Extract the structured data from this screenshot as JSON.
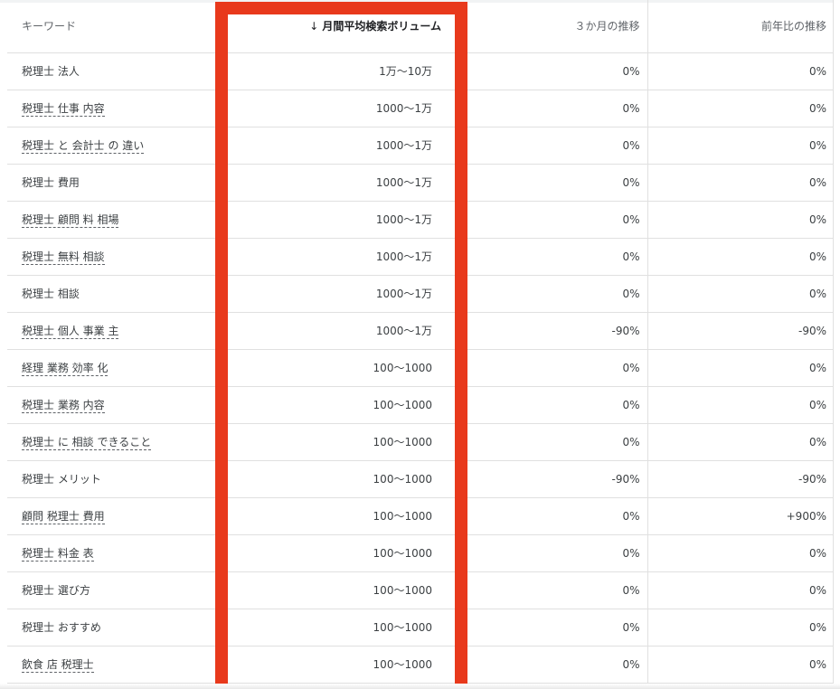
{
  "headers": {
    "keyword": "キーワード",
    "sort_icon": "↓",
    "volume": "月間平均検索ボリューム",
    "three_month": "３か月の推移",
    "yoy": "前年比の推移"
  },
  "rows": [
    {
      "keyword": "税理士 法人",
      "dashed": false,
      "volume": "1万～10万",
      "three_month": "0%",
      "yoy": "0%"
    },
    {
      "keyword": "税理士 仕事 内容",
      "dashed": true,
      "volume": "1000～1万",
      "three_month": "0%",
      "yoy": "0%"
    },
    {
      "keyword": "税理士 と 会計士 の 違い",
      "dashed": true,
      "volume": "1000～1万",
      "three_month": "0%",
      "yoy": "0%"
    },
    {
      "keyword": "税理士 費用",
      "dashed": false,
      "volume": "1000～1万",
      "three_month": "0%",
      "yoy": "0%"
    },
    {
      "keyword": "税理士 顧問 料 相場",
      "dashed": true,
      "volume": "1000～1万",
      "three_month": "0%",
      "yoy": "0%"
    },
    {
      "keyword": "税理士 無料 相談",
      "dashed": true,
      "volume": "1000～1万",
      "three_month": "0%",
      "yoy": "0%"
    },
    {
      "keyword": "税理士 相談",
      "dashed": false,
      "volume": "1000～1万",
      "three_month": "0%",
      "yoy": "0%"
    },
    {
      "keyword": "税理士 個人 事業 主",
      "dashed": true,
      "volume": "1000～1万",
      "three_month": "-90%",
      "yoy": "-90%"
    },
    {
      "keyword": "経理 業務 効率 化",
      "dashed": true,
      "volume": "100～1000",
      "three_month": "0%",
      "yoy": "0%"
    },
    {
      "keyword": "税理士 業務 内容",
      "dashed": true,
      "volume": "100～1000",
      "three_month": "0%",
      "yoy": "0%"
    },
    {
      "keyword": "税理士 に 相談 できること",
      "dashed": true,
      "volume": "100～1000",
      "three_month": "0%",
      "yoy": "0%"
    },
    {
      "keyword": "税理士 メリット",
      "dashed": false,
      "volume": "100～1000",
      "three_month": "-90%",
      "yoy": "-90%"
    },
    {
      "keyword": "顧問 税理士 費用",
      "dashed": true,
      "volume": "100～1000",
      "three_month": "0%",
      "yoy": "+900%"
    },
    {
      "keyword": "税理士 料金 表",
      "dashed": true,
      "volume": "100～1000",
      "three_month": "0%",
      "yoy": "0%"
    },
    {
      "keyword": "税理士 選び方",
      "dashed": false,
      "volume": "100～1000",
      "three_month": "0%",
      "yoy": "0%"
    },
    {
      "keyword": "税理士 おすすめ",
      "dashed": false,
      "volume": "100～1000",
      "three_month": "0%",
      "yoy": "0%"
    },
    {
      "keyword": "飲食 店 税理士",
      "dashed": true,
      "volume": "100～1000",
      "three_month": "0%",
      "yoy": "0%"
    }
  ],
  "colors": {
    "highlight": "#e8391c",
    "divider": "#e0e0e0",
    "text": "#3c4043"
  }
}
